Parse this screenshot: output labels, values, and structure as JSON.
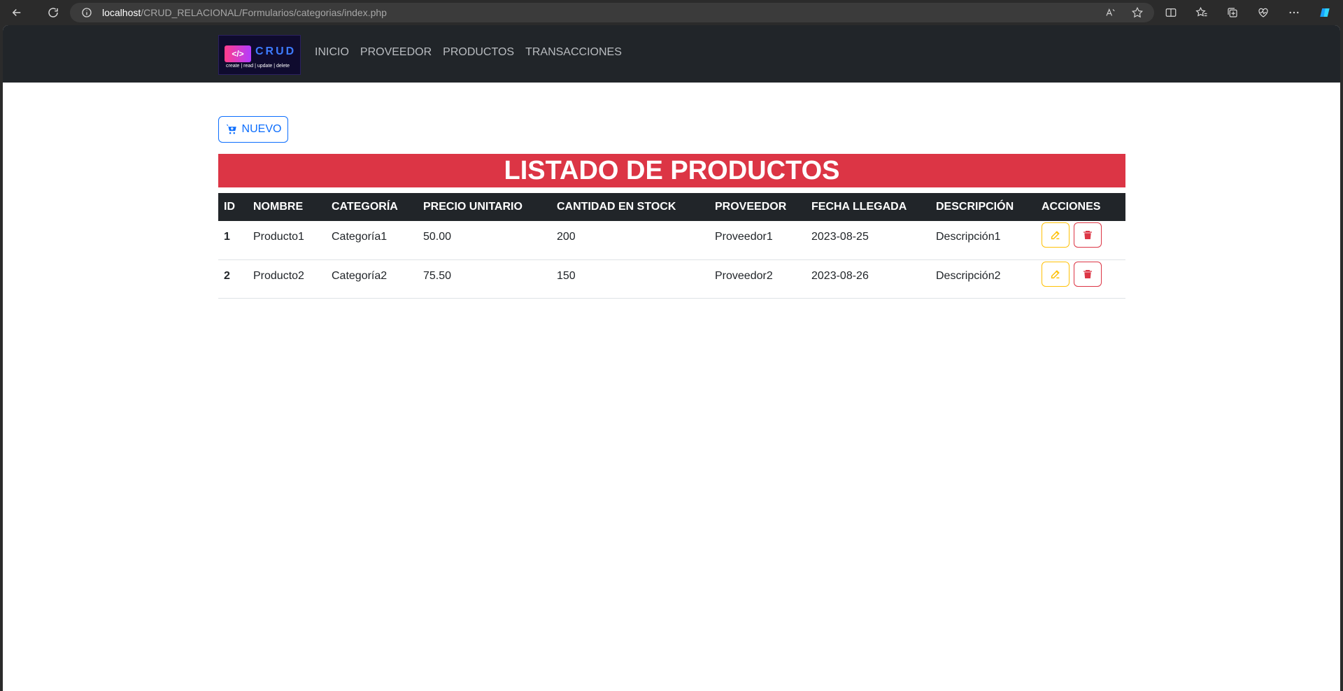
{
  "browser": {
    "url_host": "localhost",
    "url_path": "/CRUD_RELACIONAL/Formularios/categorias/index.php"
  },
  "nav": {
    "logo_word": "CRUD",
    "logo_symbol": "</>",
    "logo_tagline": "create | read | update | delete",
    "links": [
      "INICIO",
      "PROVEEDOR",
      "PRODUCTOS",
      "TRANSACCIONES"
    ]
  },
  "page": {
    "new_button_label": "NUEVO",
    "title": "LISTADO DE PRODUCTOS"
  },
  "table": {
    "headers": [
      "ID",
      "NOMBRE",
      "CATEGORÍA",
      "PRECIO UNITARIO",
      "CANTIDAD EN STOCK",
      "PROVEEDOR",
      "FECHA LLEGADA",
      "DESCRIPCIÓN",
      "ACCIONES"
    ],
    "rows": [
      {
        "id": "1",
        "nombre": "Producto1",
        "categoria": "Categoría1",
        "precio": "50.00",
        "cantidad": "200",
        "proveedor": "Proveedor1",
        "fecha": "2023-08-25",
        "descripcion": "Descripción1"
      },
      {
        "id": "2",
        "nombre": "Producto2",
        "categoria": "Categoría2",
        "precio": "75.50",
        "cantidad": "150",
        "proveedor": "Proveedor2",
        "fecha": "2023-08-26",
        "descripcion": "Descripción2"
      }
    ]
  },
  "colors": {
    "navbar": "#212529",
    "title_bg": "#dc3545",
    "primary": "#0d6efd",
    "warning": "#ffc107",
    "danger": "#dc3545"
  }
}
